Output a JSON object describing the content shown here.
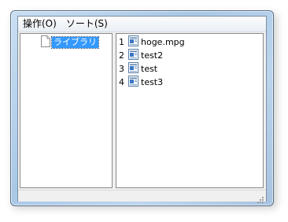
{
  "menubar": {
    "items": [
      {
        "label": "操作(O)"
      },
      {
        "label": "ソート(S)"
      }
    ]
  },
  "tree": {
    "selected_label": "ライブラリ"
  },
  "file_list": {
    "items": [
      {
        "index": "1",
        "name": "hoge.mpg"
      },
      {
        "index": "2",
        "name": "test2"
      },
      {
        "index": "3",
        "name": "test"
      },
      {
        "index": "4",
        "name": "test3"
      }
    ]
  },
  "colors": {
    "selection_bg": "#3399ff",
    "frame": "#a9c8e6"
  }
}
